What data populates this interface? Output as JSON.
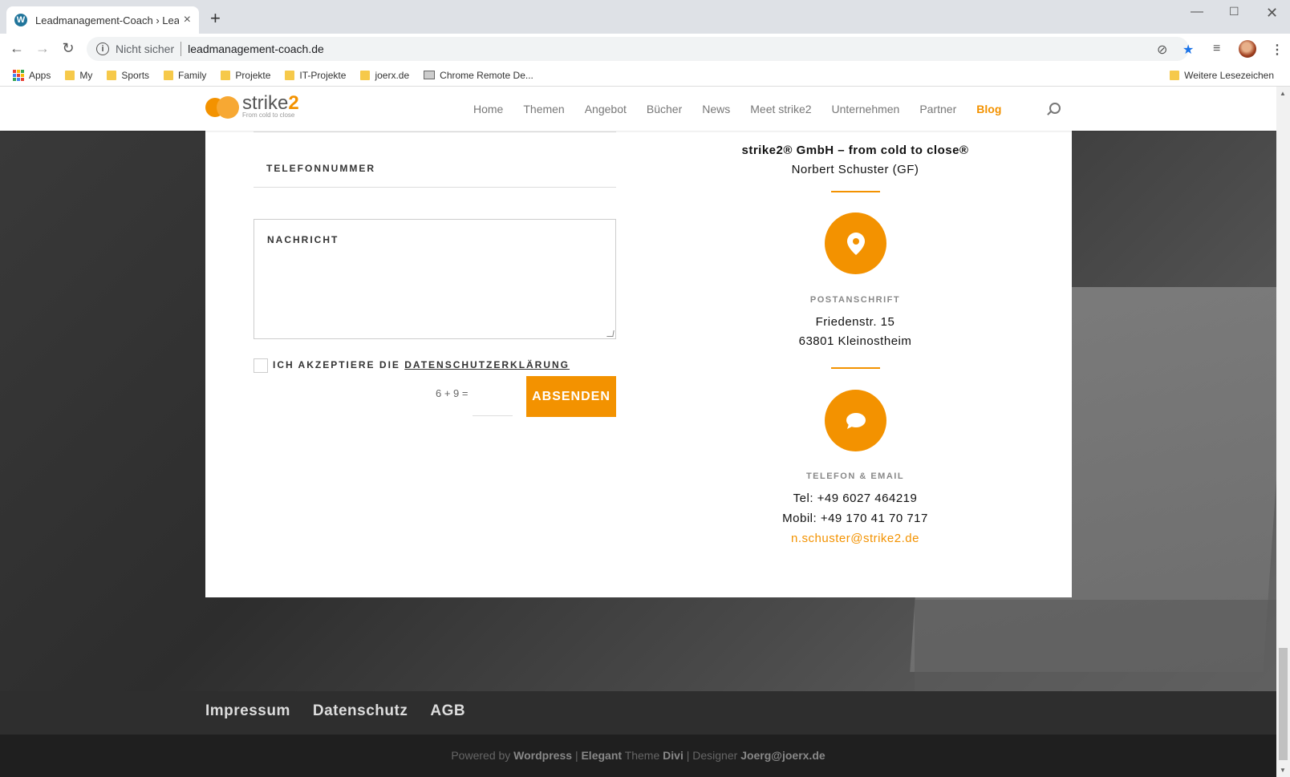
{
  "browser": {
    "tab_title": "Leadmanagement-Coach › Lead",
    "tab_close": "×",
    "new_tab": "+",
    "security_label": "Nicht sicher",
    "url": "leadmanagement-coach.de",
    "bookmarks": [
      {
        "label": "Apps",
        "icon": "apps-grid-icon"
      },
      {
        "label": "My",
        "icon": "folder-icon"
      },
      {
        "label": "Sports",
        "icon": "folder-icon"
      },
      {
        "label": "Family",
        "icon": "folder-icon"
      },
      {
        "label": "Projekte",
        "icon": "folder-icon"
      },
      {
        "label": "IT-Projekte",
        "icon": "folder-icon"
      },
      {
        "label": "joerx.de",
        "icon": "folder-icon"
      },
      {
        "label": "Chrome Remote De...",
        "icon": "remote-desktop-icon"
      }
    ],
    "other_bookmarks": "Weitere Lesezeichen",
    "accent": "#1a73e8"
  },
  "site": {
    "logo_brand": "strike",
    "logo_brand_num": "2",
    "logo_tagline": "From cold to close",
    "nav": [
      "Home",
      "Themen",
      "Angebot",
      "Bücher",
      "News",
      "Meet strike2",
      "Unternehmen",
      "Partner",
      "Blog"
    ],
    "nav_active": "Blog",
    "accent": "#f39200"
  },
  "form": {
    "phone_label": "TELEFONNUMMER",
    "message_label": "NACHRICHT",
    "consent_prefix": "ICH AKZEPTIERE DIE",
    "consent_link": "DATENSCHUTZERKLÄRUNG",
    "captcha_question": "6 + 9 =",
    "captcha_value": "",
    "submit_label": "ABSENDEN"
  },
  "contact": {
    "company": "strike2® GmbH – from cold to close®",
    "person": "Norbert Schuster (GF)",
    "address_title": "POSTANSCHRIFT",
    "street": "Friedenstr. 15",
    "city": "63801 Kleinostheim",
    "phone_title": "TELEFON & EMAIL",
    "tel": "Tel: +49 6027 464219",
    "mobile": "Mobil: +49 170 41 70 717",
    "email": "n.schuster@strike2.de"
  },
  "footer": {
    "links": [
      "Impressum",
      "Datenschutz",
      "AGB"
    ],
    "powered_prefix": "Powered by",
    "powered_wp": "Wordpress",
    "sep1": "|",
    "elegant": "Elegant",
    "theme_word": "Theme",
    "divi": "Divi",
    "sep2": "|",
    "designer_prefix": "Designer",
    "designer": "Joerg@joerx.de"
  }
}
